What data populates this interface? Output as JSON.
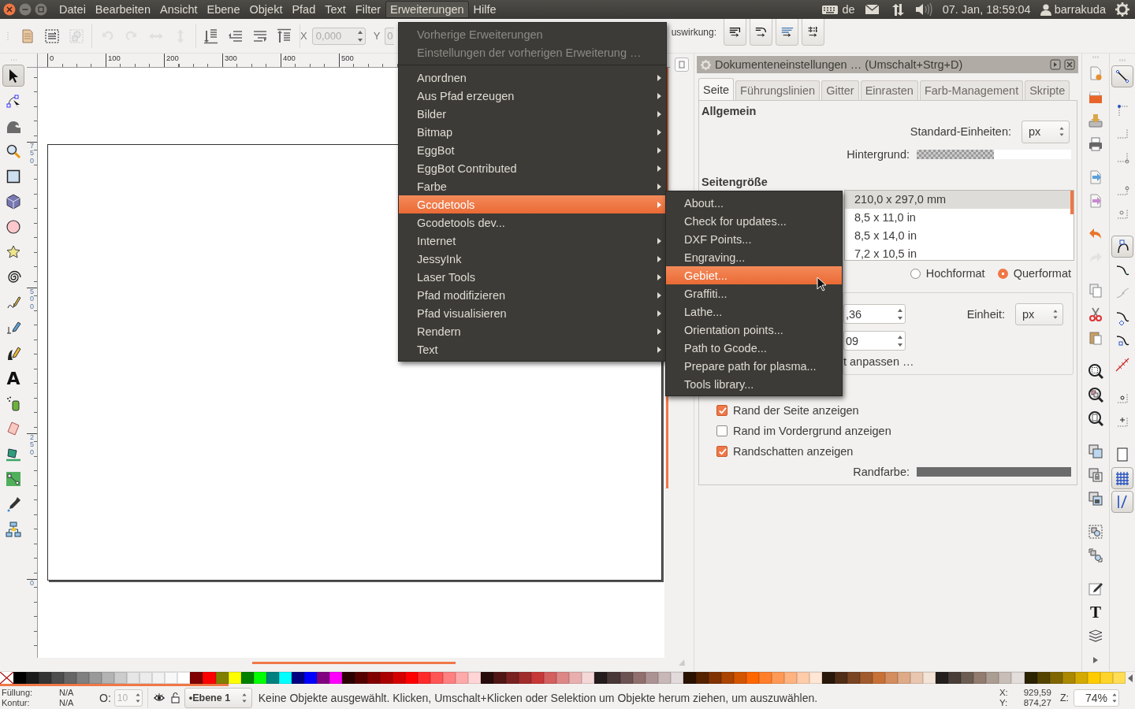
{
  "menu_bar": [
    {
      "label": "Datei",
      "selected": false
    },
    {
      "label": "Bearbeiten",
      "selected": false
    },
    {
      "label": "Ansicht",
      "selected": false
    },
    {
      "label": "Ebene",
      "selected": false
    },
    {
      "label": "Objekt",
      "selected": false
    },
    {
      "label": "Pfad",
      "selected": false
    },
    {
      "label": "Text",
      "selected": false
    },
    {
      "label": "Filter",
      "selected": false
    },
    {
      "label": "Erweiterungen",
      "selected": true
    },
    {
      "label": "Hilfe",
      "selected": false
    }
  ],
  "indicators": {
    "keyboard_layout": "de",
    "clock": "07. Jan, 18:59:04",
    "user": "barrakuda"
  },
  "toolbar": {
    "buttons": [
      {
        "disabled": false
      },
      {
        "disabled": false
      },
      {
        "disabled": true
      },
      {
        "disabled": true
      },
      {
        "disabled": true
      },
      {
        "disabled": true
      },
      {
        "disabled": true
      },
      {
        "disabled": false
      },
      {
        "disabled": false
      },
      {
        "disabled": false
      },
      {
        "disabled": false
      }
    ],
    "x_label": "X",
    "x_value": "0,000",
    "y_label": "Y",
    "y_value": "0",
    "effect_label": "uswirkung:"
  },
  "rulers": {
    "horizontal": [
      "0",
      "100",
      "200",
      "300",
      "400",
      "500"
    ],
    "vertical": [
      "750",
      "500",
      "250",
      "0"
    ]
  },
  "toolbox": [
    {
      "selected": true
    },
    {
      "selected": false
    },
    {
      "selected": false
    },
    {
      "selected": false
    },
    {
      "selected": false
    },
    {
      "selected": false
    },
    {
      "selected": false
    },
    {
      "selected": false
    },
    {
      "selected": false
    },
    {
      "selected": false
    },
    {
      "selected": false
    },
    {
      "selected": false
    },
    {
      "selected": false,
      "glyph": "A"
    },
    {
      "selected": false
    },
    {
      "selected": false
    },
    {
      "selected": false
    },
    {
      "selected": false
    },
    {
      "selected": false
    },
    {
      "selected": false
    }
  ],
  "extensions_menu": [
    {
      "kind": "item",
      "label": "Vorherige Erweiterungen",
      "disabled": true,
      "submenu": false,
      "selected": false
    },
    {
      "kind": "item",
      "label": "Einstellungen der vorherigen Erweiterung …",
      "disabled": true,
      "submenu": false,
      "selected": false
    },
    {
      "kind": "separator"
    },
    {
      "kind": "item",
      "label": "Anordnen",
      "disabled": false,
      "submenu": true,
      "selected": false
    },
    {
      "kind": "item",
      "label": "Aus Pfad erzeugen",
      "disabled": false,
      "submenu": true,
      "selected": false
    },
    {
      "kind": "item",
      "label": "Bilder",
      "disabled": false,
      "submenu": true,
      "selected": false
    },
    {
      "kind": "item",
      "label": "Bitmap",
      "disabled": false,
      "submenu": true,
      "selected": false
    },
    {
      "kind": "item",
      "label": "EggBot",
      "disabled": false,
      "submenu": true,
      "selected": false
    },
    {
      "kind": "item",
      "label": "EggBot Contributed",
      "disabled": false,
      "submenu": true,
      "selected": false
    },
    {
      "kind": "item",
      "label": "Farbe",
      "disabled": false,
      "submenu": true,
      "selected": false
    },
    {
      "kind": "item",
      "label": "Gcodetools",
      "disabled": false,
      "submenu": true,
      "selected": true
    },
    {
      "kind": "item",
      "label": "Gcodetools dev...",
      "disabled": false,
      "submenu": false,
      "selected": false
    },
    {
      "kind": "item",
      "label": "Internet",
      "disabled": false,
      "submenu": true,
      "selected": false
    },
    {
      "kind": "item",
      "label": "JessyInk",
      "disabled": false,
      "submenu": true,
      "selected": false
    },
    {
      "kind": "item",
      "label": "Laser Tools",
      "disabled": false,
      "submenu": true,
      "selected": false
    },
    {
      "kind": "item",
      "label": "Pfad modifizieren",
      "disabled": false,
      "submenu": true,
      "selected": false
    },
    {
      "kind": "item",
      "label": "Pfad visualisieren",
      "disabled": false,
      "submenu": true,
      "selected": false
    },
    {
      "kind": "item",
      "label": "Rendern",
      "disabled": false,
      "submenu": true,
      "selected": false
    },
    {
      "kind": "item",
      "label": "Text",
      "disabled": false,
      "submenu": true,
      "selected": false
    }
  ],
  "gcodetools_submenu": [
    {
      "label": "About...",
      "selected": false
    },
    {
      "label": "Check for updates...",
      "selected": false
    },
    {
      "label": "DXF Points...",
      "selected": false
    },
    {
      "label": "Engraving...",
      "selected": false
    },
    {
      "label": "Gebiet...",
      "selected": true
    },
    {
      "label": "Graffiti...",
      "selected": false
    },
    {
      "label": "Lathe...",
      "selected": false
    },
    {
      "label": "Orientation points...",
      "selected": false
    },
    {
      "label": "Path to Gcode...",
      "selected": false
    },
    {
      "label": "Prepare path for plasma...",
      "selected": false
    },
    {
      "label": "Tools library...",
      "selected": false
    }
  ],
  "document_properties": {
    "title": "Dokumenteneinstellungen … (Umschalt+Strg+D)",
    "tabs": [
      {
        "label": "Seite",
        "selected": true
      },
      {
        "label": "Führungslinien",
        "selected": false
      },
      {
        "label": "Gitter",
        "selected": false
      },
      {
        "label": "Einrasten",
        "selected": false
      },
      {
        "label": "Farb-Management",
        "selected": false
      },
      {
        "label": "Skripte",
        "selected": false
      }
    ],
    "general_heading": "Allgemein",
    "default_units_label": "Standard-Einheiten:",
    "default_units": "px",
    "background_label": "Hintergrund:",
    "page_size_heading": "Seitengröße",
    "page_sizes": [
      {
        "label": "210,0 x 297,0 mm",
        "selected": true
      },
      {
        "label": "8,5 x 11,0 in",
        "selected": false
      },
      {
        "label": "8,5 x 14,0 in",
        "selected": false
      },
      {
        "label": "7,2 x 10,5 in",
        "selected": false
      }
    ],
    "orientation": [
      {
        "label": "Hochformat",
        "selected": false
      },
      {
        "label": "Querformat",
        "selected": true
      }
    ],
    "width_value": ",36",
    "height_value": "09",
    "unit_label": "Einheit:",
    "unit": "px",
    "fit_link": "t anpassen …",
    "border_options": [
      {
        "label": "Rand der Seite anzeigen",
        "checked": true
      },
      {
        "label": "Rand im Vordergrund anzeigen",
        "checked": false
      },
      {
        "label": "Randschatten anzeigen",
        "checked": true
      }
    ],
    "border_color_label": "Randfarbe:"
  },
  "commands": [
    {
      "disabled": false
    },
    {
      "disabled": false
    },
    {
      "disabled": false
    },
    {
      "disabled": false
    },
    {
      "disabled": false
    },
    {
      "disabled": false
    },
    {
      "disabled": false
    },
    {
      "disabled": true
    },
    {
      "disabled": false
    },
    {
      "disabled": false
    },
    {
      "disabled": false
    },
    {
      "disabled": false
    },
    {
      "disabled": false
    },
    {
      "disabled": false
    },
    {
      "disabled": false
    },
    {
      "disabled": false
    },
    {
      "disabled": false
    },
    {
      "disabled": false
    },
    {
      "disabled": false
    },
    {
      "disabled": false
    },
    {
      "disabled": false,
      "glyph": "T"
    },
    {
      "disabled": false
    }
  ],
  "snap_controls": [
    {
      "on": true
    },
    {
      "on": false
    },
    {
      "on": false
    },
    {
      "on": false
    },
    {
      "on": false
    },
    {
      "on": false
    },
    {
      "on": true
    },
    {
      "on": false
    },
    {
      "on": false
    },
    {
      "on": false
    },
    {
      "on": false
    },
    {
      "on": false
    },
    {
      "on": false
    },
    {
      "on": false
    },
    {
      "on": false
    },
    {
      "on": true
    },
    {
      "on": true
    }
  ],
  "palette": [
    {
      "kind": "none"
    },
    {
      "kind": "color",
      "color": "#000000"
    },
    {
      "kind": "color",
      "color": "#1a1a1a"
    },
    {
      "kind": "color",
      "color": "#333333"
    },
    {
      "kind": "color",
      "color": "#4d4d4d"
    },
    {
      "kind": "color",
      "color": "#666666"
    },
    {
      "kind": "color",
      "color": "#808080"
    },
    {
      "kind": "color",
      "color": "#999999"
    },
    {
      "kind": "color",
      "color": "#b3b3b3"
    },
    {
      "kind": "color",
      "color": "#cccccc"
    },
    {
      "kind": "color",
      "color": "#e6e6e6"
    },
    {
      "kind": "color",
      "color": "#ececec"
    },
    {
      "kind": "color",
      "color": "#f2f2f2"
    },
    {
      "kind": "color",
      "color": "#f8f8f8"
    },
    {
      "kind": "color",
      "color": "#ffffff"
    },
    {
      "kind": "color",
      "color": "#800000"
    },
    {
      "kind": "color",
      "color": "#ff0000"
    },
    {
      "kind": "color",
      "color": "#808000"
    },
    {
      "kind": "color",
      "color": "#ffff00"
    },
    {
      "kind": "color",
      "color": "#008000"
    },
    {
      "kind": "color",
      "color": "#00ff00"
    },
    {
      "kind": "color",
      "color": "#008080"
    },
    {
      "kind": "color",
      "color": "#00ffff"
    },
    {
      "kind": "color",
      "color": "#000080"
    },
    {
      "kind": "color",
      "color": "#0000ff"
    },
    {
      "kind": "color",
      "color": "#800080"
    },
    {
      "kind": "color",
      "color": "#ff00ff"
    },
    {
      "kind": "color",
      "color": "#2b0000"
    },
    {
      "kind": "color",
      "color": "#550000"
    },
    {
      "kind": "color",
      "color": "#800000"
    },
    {
      "kind": "color",
      "color": "#aa0000"
    },
    {
      "kind": "color",
      "color": "#d40000"
    },
    {
      "kind": "color",
      "color": "#ff0000"
    },
    {
      "kind": "color",
      "color": "#ff2a2a"
    },
    {
      "kind": "color",
      "color": "#ff5555"
    },
    {
      "kind": "color",
      "color": "#ff8080"
    },
    {
      "kind": "color",
      "color": "#ffaaaa"
    },
    {
      "kind": "color",
      "color": "#ffd5d5"
    },
    {
      "kind": "color",
      "color": "#280b0b"
    },
    {
      "kind": "color",
      "color": "#501616"
    },
    {
      "kind": "color",
      "color": "#782121"
    },
    {
      "kind": "color",
      "color": "#a02c2c"
    },
    {
      "kind": "color",
      "color": "#c83737"
    },
    {
      "kind": "color",
      "color": "#d35f5f"
    },
    {
      "kind": "color",
      "color": "#de8787"
    },
    {
      "kind": "color",
      "color": "#e9afaf"
    },
    {
      "kind": "color",
      "color": "#f4d7d7"
    },
    {
      "kind": "color",
      "color": "#241c1c"
    },
    {
      "kind": "color",
      "color": "#483737"
    },
    {
      "kind": "color",
      "color": "#6c5353"
    },
    {
      "kind": "color",
      "color": "#916f6f"
    },
    {
      "kind": "color",
      "color": "#ac9393"
    },
    {
      "kind": "color",
      "color": "#c8b7b7"
    },
    {
      "kind": "color",
      "color": "#e3dbdb"
    },
    {
      "kind": "color",
      "color": "#2b1100"
    },
    {
      "kind": "color",
      "color": "#552200"
    },
    {
      "kind": "color",
      "color": "#803300"
    },
    {
      "kind": "color",
      "color": "#aa4400"
    },
    {
      "kind": "color",
      "color": "#d45500"
    },
    {
      "kind": "color",
      "color": "#ff6600"
    },
    {
      "kind": "color",
      "color": "#ff7f2a"
    },
    {
      "kind": "color",
      "color": "#ff9955"
    },
    {
      "kind": "color",
      "color": "#ffb380"
    },
    {
      "kind": "color",
      "color": "#ffccaa"
    },
    {
      "kind": "color",
      "color": "#ffe6d5"
    },
    {
      "kind": "color",
      "color": "#28170b"
    },
    {
      "kind": "color",
      "color": "#502d16"
    },
    {
      "kind": "color",
      "color": "#784421"
    },
    {
      "kind": "color",
      "color": "#a05a2c"
    },
    {
      "kind": "color",
      "color": "#c87137"
    },
    {
      "kind": "color",
      "color": "#d38d5f"
    },
    {
      "kind": "color",
      "color": "#deaa87"
    },
    {
      "kind": "color",
      "color": "#e9c6af"
    },
    {
      "kind": "color",
      "color": "#f4e3d7"
    },
    {
      "kind": "color",
      "color": "#241f1c"
    },
    {
      "kind": "color",
      "color": "#483e37"
    },
    {
      "kind": "color",
      "color": "#6c5d53"
    },
    {
      "kind": "color",
      "color": "#917c6f"
    },
    {
      "kind": "color",
      "color": "#ac9d93"
    },
    {
      "kind": "color",
      "color": "#c8beb7"
    },
    {
      "kind": "color",
      "color": "#e3dedb"
    },
    {
      "kind": "color",
      "color": "#2b2200"
    },
    {
      "kind": "color",
      "color": "#554400"
    },
    {
      "kind": "color",
      "color": "#806600"
    },
    {
      "kind": "color",
      "color": "#aa8800"
    },
    {
      "kind": "color",
      "color": "#d4aa00"
    },
    {
      "kind": "color",
      "color": "#ffcc00"
    },
    {
      "kind": "color",
      "color": "#ffd42a"
    },
    {
      "kind": "color",
      "color": "#ffdd55"
    }
  ],
  "status_bar": {
    "fill_label": "Füllung:",
    "fill_value": "N/A",
    "stroke_label": "Kontur:",
    "stroke_value": "N/A",
    "opacity_label": "O:",
    "opacity_value": "10",
    "layer": "•Ebene 1",
    "message": "Keine Objekte ausgewählt. Klicken, Umschalt+Klicken oder Selektion um Objekte herum ziehen, um auszuwählen.",
    "x_label": "X:",
    "x_value": "929,59",
    "y_label": "Y:",
    "y_value": "874,27",
    "zoom_label": "Z:",
    "zoom_value": "74%"
  }
}
